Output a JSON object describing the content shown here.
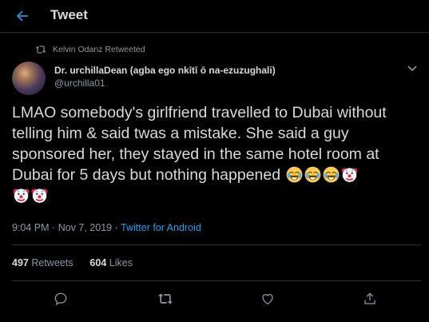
{
  "header": {
    "title": "Tweet"
  },
  "retweet": {
    "text": "Kelvin Odanz Retweeted"
  },
  "author": {
    "display_name": "Dr. urchillaDean (agba ego nkītī ō na-ezuzughali)",
    "handle": "@urchilla01"
  },
  "tweet": {
    "text": "LMAO somebody's girlfriend travelled to Dubai without telling him & said twas a mistake. She said a guy sponsored her, they stayed in the same hotel room at Dubai for 5 days but nothing happened",
    "emojis": [
      "joy-emoji",
      "joy-emoji",
      "joy-emoji",
      "clown-emoji",
      "clown-emoji",
      "clown-emoji"
    ]
  },
  "meta": {
    "time": "9:04 PM",
    "date": "Nov 7, 2019",
    "separator": "·",
    "source": "Twitter for Android"
  },
  "stats": {
    "retweets_count": "497",
    "retweets_label": "Retweets",
    "likes_count": "604",
    "likes_label": "Likes"
  },
  "colors": {
    "background": "#000000",
    "text": "#d9d9d9",
    "secondary": "#8899a6",
    "accent": "#1da1f2",
    "divider": "#2f3336"
  }
}
